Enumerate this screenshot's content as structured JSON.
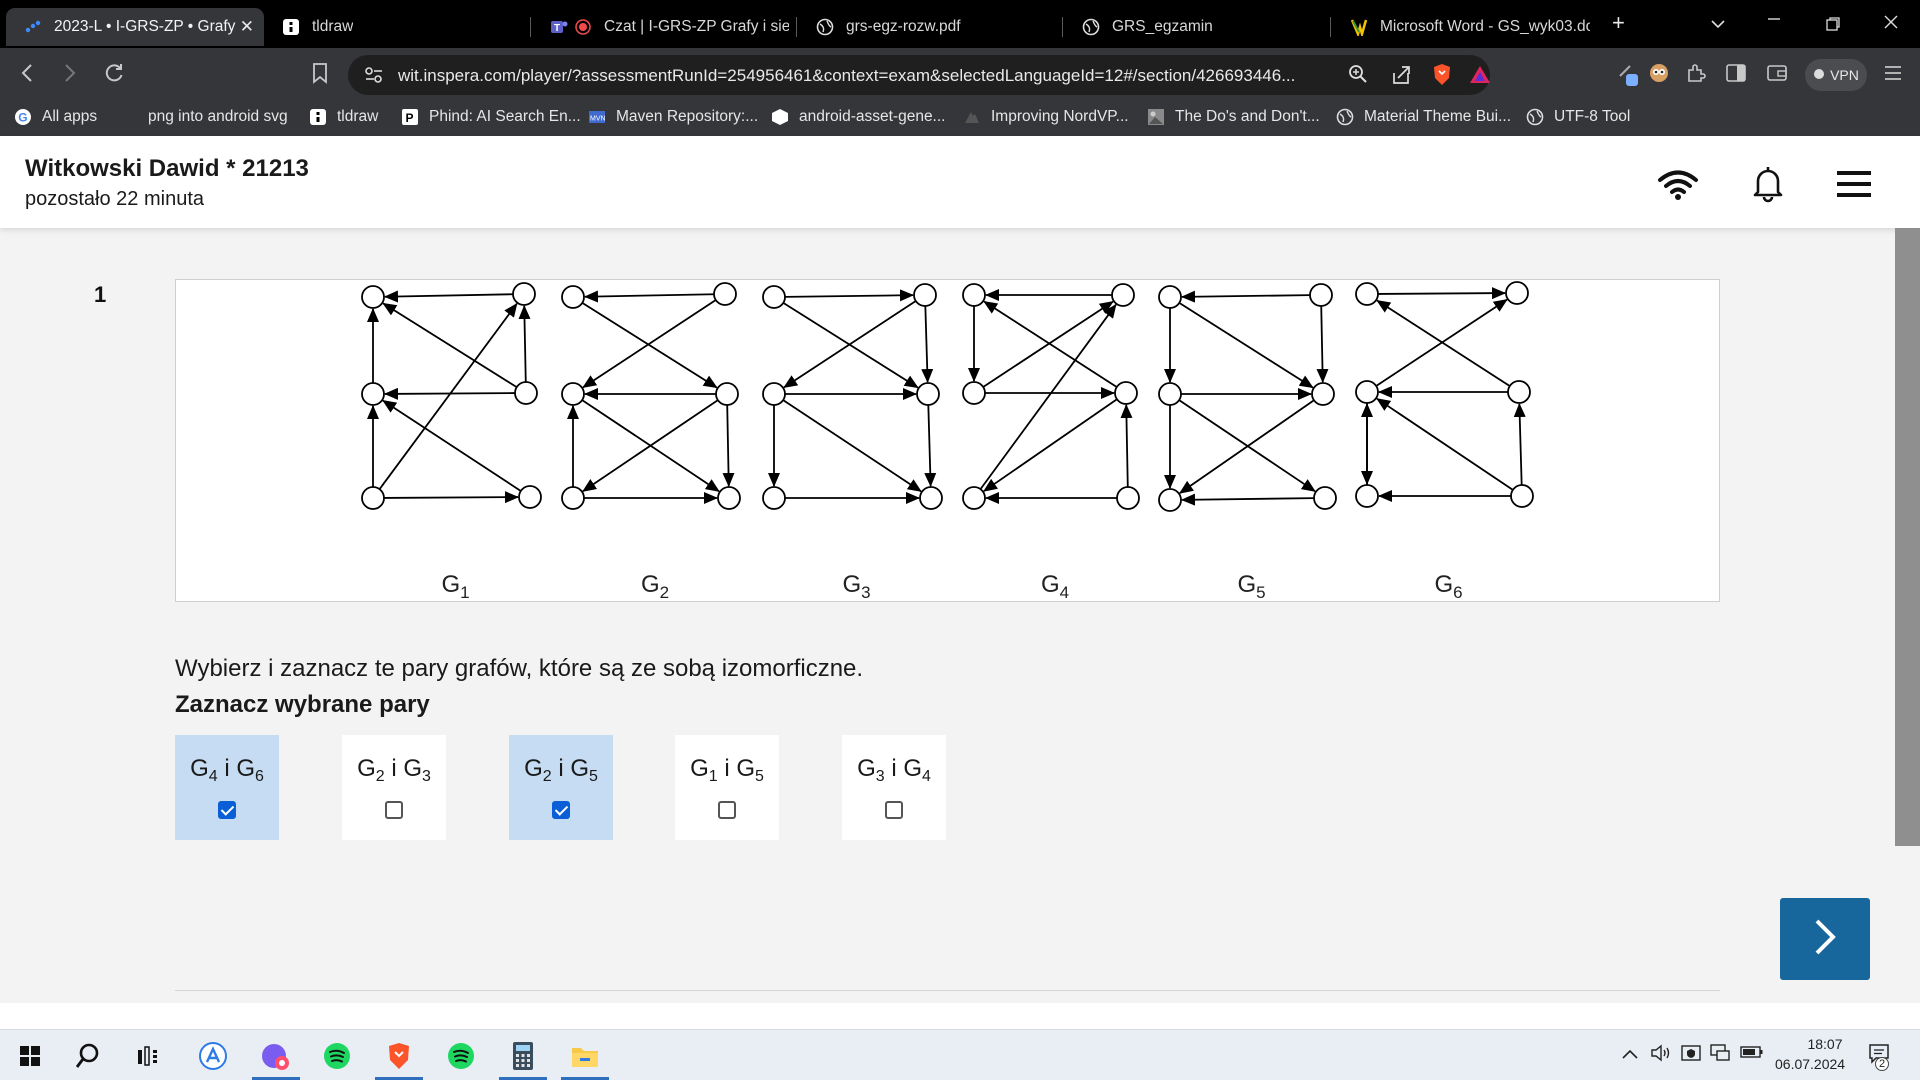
{
  "browser": {
    "tabs": [
      {
        "title": "2023-L • I-GRS-ZP • Grafy i",
        "active": true,
        "icon": "inspera-icon"
      },
      {
        "title": "tldraw",
        "active": false,
        "icon": "tldraw-icon"
      },
      {
        "title": "Czat | I-GRS-ZP Grafy i sieci",
        "active": false,
        "icon": "teams-icon"
      },
      {
        "title": "grs-egz-rozw.pdf",
        "active": false,
        "icon": "globe-icon"
      },
      {
        "title": "GRS_egzamin",
        "active": false,
        "icon": "globe-icon"
      },
      {
        "title": "Microsoft Word - GS_wyk03.do",
        "active": false,
        "icon": "word-doc-icon"
      }
    ],
    "url": "wit.inspera.com/player/?assessmentRunId=254956461&context=exam&selectedLanguageId=12#/section/426693446...",
    "vpn_label": "VPN",
    "bookmarks": [
      {
        "label": "All apps",
        "icon": "google-icon"
      },
      {
        "label": "png into android svg",
        "icon": ""
      },
      {
        "label": "tldraw",
        "icon": "tldraw-icon"
      },
      {
        "label": "Phind: AI Search En...",
        "icon": "phind-icon"
      },
      {
        "label": "Maven Repository:...",
        "icon": "maven-icon"
      },
      {
        "label": "android-asset-gene...",
        "icon": "cube-icon"
      },
      {
        "label": "Improving NordVP...",
        "icon": "nordvpn-icon"
      },
      {
        "label": "The Do's and Don't...",
        "icon": "photo-icon"
      },
      {
        "label": "Material Theme Bui...",
        "icon": "globe-icon"
      },
      {
        "label": "UTF-8 Tool",
        "icon": "globe-icon"
      }
    ]
  },
  "header": {
    "student": "Witkowski Dawid * 21213",
    "time_left": "pozostało 22 minuta"
  },
  "question": {
    "number": "1",
    "prompt": "Wybierz i zaznacz te pary grafów, które są ze sobą izomorficzne.",
    "subprompt": "Zaznacz wybrane pary",
    "graph_labels": [
      {
        "letter": "G",
        "index": "1"
      },
      {
        "letter": "G",
        "index": "2"
      },
      {
        "letter": "G",
        "index": "3"
      },
      {
        "letter": "G",
        "index": "4"
      },
      {
        "letter": "G",
        "index": "5"
      },
      {
        "letter": "G",
        "index": "6"
      }
    ],
    "options": [
      {
        "a": "4",
        "b": "6",
        "joiner": "i",
        "checked": true
      },
      {
        "a": "2",
        "b": "3",
        "joiner": "i",
        "checked": false
      },
      {
        "a": "2",
        "b": "5",
        "joiner": "i",
        "checked": true
      },
      {
        "a": "1",
        "b": "5",
        "joiner": "i",
        "checked": false
      },
      {
        "a": "3",
        "b": "4",
        "joiner": "i",
        "checked": false
      }
    ]
  },
  "taskbar": {
    "time": "18:07",
    "date": "06.07.2024",
    "notifications": "2"
  },
  "colors": {
    "selected_option_bg": "#c5dcf3",
    "next_button": "#17679c",
    "checkbox_checked": "#0b5fd6"
  }
}
